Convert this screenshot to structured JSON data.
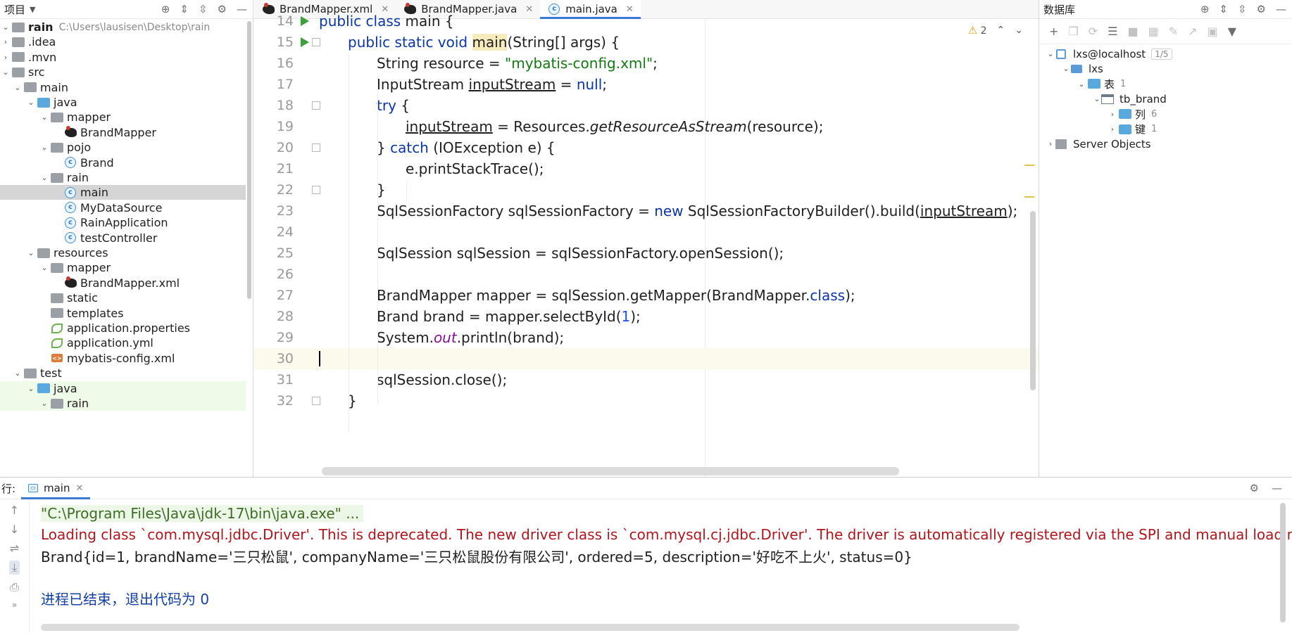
{
  "project": {
    "title": "项目",
    "tree": [
      {
        "label": "rain",
        "path": "C:\\Users\\lausisen\\Desktop\\rain",
        "indent": 0,
        "arrow": "v",
        "icon": "folder",
        "bold": true
      },
      {
        "label": ".idea",
        "indent": 0,
        "arrow": ">",
        "icon": "folder"
      },
      {
        "label": ".mvn",
        "indent": 0,
        "arrow": ">",
        "icon": "folder"
      },
      {
        "label": "src",
        "indent": 0,
        "arrow": "v",
        "icon": "folder"
      },
      {
        "label": "main",
        "indent": 1,
        "arrow": "v",
        "icon": "folder"
      },
      {
        "label": "java",
        "indent": 2,
        "arrow": "v",
        "icon": "folder-blue"
      },
      {
        "label": "mapper",
        "indent": 3,
        "arrow": "v",
        "icon": "folder"
      },
      {
        "label": "BrandMapper",
        "indent": 4,
        "arrow": "",
        "icon": "bird"
      },
      {
        "label": "pojo",
        "indent": 3,
        "arrow": "v",
        "icon": "folder"
      },
      {
        "label": "Brand",
        "indent": 4,
        "arrow": "",
        "icon": "class"
      },
      {
        "label": "rain",
        "indent": 3,
        "arrow": "v",
        "icon": "folder"
      },
      {
        "label": "main",
        "indent": 4,
        "arrow": "",
        "icon": "class",
        "selected": true
      },
      {
        "label": "MyDataSource",
        "indent": 4,
        "arrow": "",
        "icon": "class"
      },
      {
        "label": "RainApplication",
        "indent": 4,
        "arrow": "",
        "icon": "class"
      },
      {
        "label": "testController",
        "indent": 4,
        "arrow": "",
        "icon": "class"
      },
      {
        "label": "resources",
        "indent": 2,
        "arrow": "v",
        "icon": "folder"
      },
      {
        "label": "mapper",
        "indent": 3,
        "arrow": "v",
        "icon": "folder"
      },
      {
        "label": "BrandMapper.xml",
        "indent": 4,
        "arrow": "",
        "icon": "bird"
      },
      {
        "label": "static",
        "indent": 3,
        "arrow": "",
        "icon": "folder"
      },
      {
        "label": "templates",
        "indent": 3,
        "arrow": "",
        "icon": "folder"
      },
      {
        "label": "application.properties",
        "indent": 3,
        "arrow": "",
        "icon": "leaf"
      },
      {
        "label": "application.yml",
        "indent": 3,
        "arrow": "",
        "icon": "leaf"
      },
      {
        "label": "mybatis-config.xml",
        "indent": 3,
        "arrow": "",
        "icon": "xml"
      },
      {
        "label": "test",
        "indent": 1,
        "arrow": "v",
        "icon": "folder"
      },
      {
        "label": "java",
        "indent": 2,
        "arrow": "v",
        "icon": "folder-blue",
        "tested": true
      },
      {
        "label": "rain",
        "indent": 3,
        "arrow": "v",
        "icon": "folder",
        "tested": true
      }
    ]
  },
  "editor": {
    "tabs": [
      {
        "label": "BrandMapper.xml",
        "icon": "bird"
      },
      {
        "label": "BrandMapper.java",
        "icon": "bird"
      },
      {
        "label": "main.java",
        "icon": "class",
        "active": true
      }
    ],
    "warnings": "2",
    "lines": [
      {
        "n": "14",
        "indent": 0,
        "run": true,
        "html": "<span class='kw'>public class</span> main {"
      },
      {
        "n": "15",
        "indent": 1,
        "run": true,
        "fold": true,
        "html": "<span class='kw'>public static void</span> <span class='hl'>main</span>(String[] args) {"
      },
      {
        "n": "16",
        "indent": 2,
        "html": "String resource = <span class='str'>\"mybatis-config.xml\"</span>;"
      },
      {
        "n": "17",
        "indent": 2,
        "html": "InputStream <span class='ul'>inputStream</span> = <span class='kw'>null</span>;"
      },
      {
        "n": "18",
        "indent": 2,
        "fold": true,
        "html": "<span class='kw'>try</span> {"
      },
      {
        "n": "19",
        "indent": 3,
        "html": "<span class='ul'>inputStream</span> = Resources.<span class='it'>getResourceAsStream</span>(resource);"
      },
      {
        "n": "20",
        "indent": 2,
        "fold": true,
        "html": "} <span class='kw'>catch</span> (IOException e) {"
      },
      {
        "n": "21",
        "indent": 3,
        "html": "e.printStackTrace();"
      },
      {
        "n": "22",
        "indent": 2,
        "fold": true,
        "html": "}"
      },
      {
        "n": "23",
        "indent": 2,
        "html": "SqlSessionFactory sqlSessionFactory = <span class='kw'>new</span> SqlSessionFactoryBuilder().build(<span class='ul'>inputStream</span>);"
      },
      {
        "n": "24",
        "indent": 2,
        "html": ""
      },
      {
        "n": "25",
        "indent": 2,
        "html": "SqlSession sqlSession = sqlSessionFactory.openSession();"
      },
      {
        "n": "26",
        "indent": 2,
        "html": ""
      },
      {
        "n": "27",
        "indent": 2,
        "html": "BrandMapper mapper = sqlSession.getMapper(BrandMapper.<span class='kw'>class</span>);"
      },
      {
        "n": "28",
        "indent": 2,
        "html": "Brand brand = mapper.selectById(<span class='num'>1</span>);"
      },
      {
        "n": "29",
        "indent": 2,
        "html": "System.<span class='stat'>out</span>.println(brand);"
      },
      {
        "n": "30",
        "indent": 0,
        "current": true,
        "html": ""
      },
      {
        "n": "31",
        "indent": 2,
        "html": "sqlSession.close();"
      },
      {
        "n": "32",
        "indent": 1,
        "fold": true,
        "html": "}"
      }
    ]
  },
  "database": {
    "title": "数据库",
    "tree": [
      {
        "label": "lxs@localhost",
        "indent": 0,
        "arrow": "v",
        "icon": "conn",
        "badge": "1/5"
      },
      {
        "label": "lxs",
        "indent": 1,
        "arrow": "v",
        "icon": "schema"
      },
      {
        "label": "表",
        "indent": 2,
        "arrow": "v",
        "icon": "folder-blue",
        "count": "1"
      },
      {
        "label": "tb_brand",
        "indent": 3,
        "arrow": "v",
        "icon": "tbl"
      },
      {
        "label": "列",
        "indent": 4,
        "arrow": ">",
        "icon": "folder-blue",
        "count": "6"
      },
      {
        "label": "键",
        "indent": 4,
        "arrow": ">",
        "icon": "folder-blue",
        "count": "1"
      },
      {
        "label": "Server Objects",
        "indent": 0,
        "arrow": ">",
        "icon": "srv"
      }
    ]
  },
  "run": {
    "label": "行:",
    "tab": "main",
    "output": [
      {
        "type": "cmd",
        "text": "\"C:\\Program Files\\Java\\jdk-17\\bin\\java.exe\" ..."
      },
      {
        "type": "err",
        "text": "Loading class `com.mysql.jdbc.Driver'. This is deprecated. The new driver class is `com.mysql.cj.jdbc.Driver'. The driver is automatically registered via the SPI and manual loading"
      },
      {
        "type": "out",
        "text": "Brand{id=1, brandName='三只松鼠', companyName='三只松鼠股份有限公司', ordered=5, description='好吃不上火', status=0}"
      },
      {
        "type": "blank",
        "text": ""
      },
      {
        "type": "exit",
        "text": "进程已结束，退出代码为 0"
      }
    ]
  }
}
